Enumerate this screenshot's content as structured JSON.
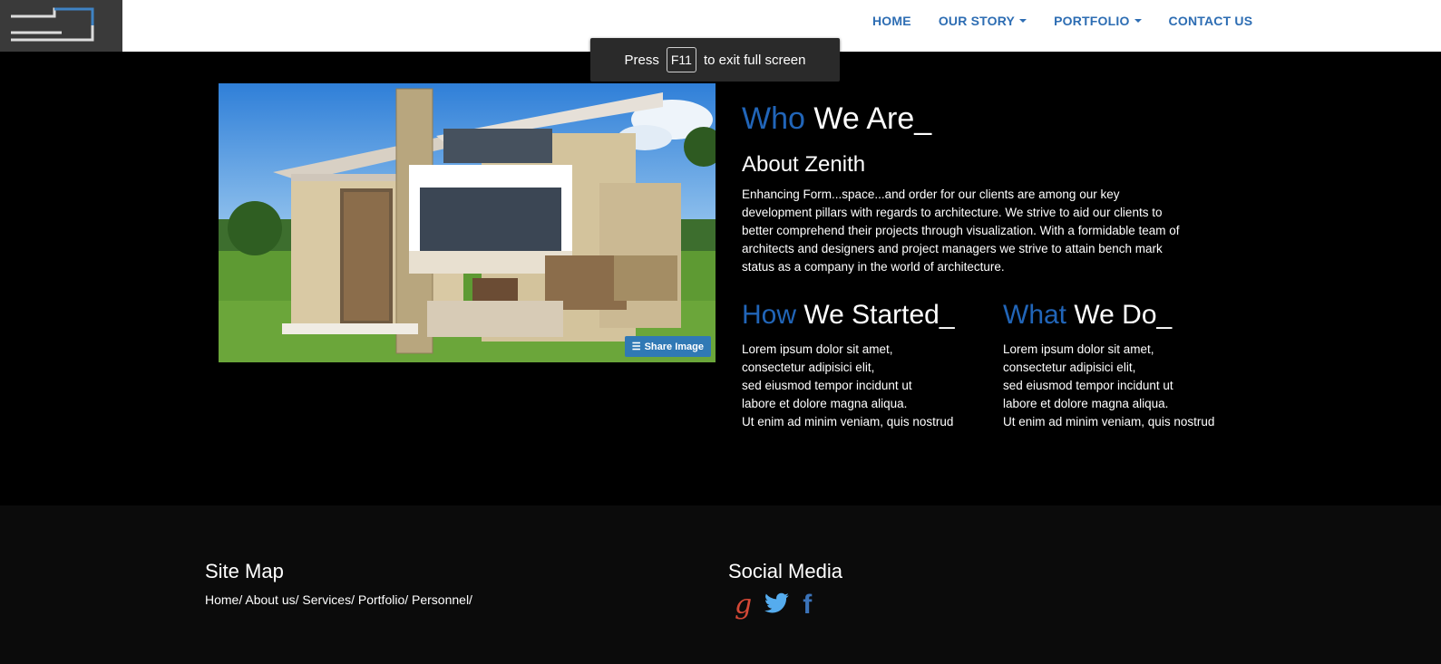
{
  "nav": {
    "items": [
      {
        "label": "HOME",
        "dropdown": false
      },
      {
        "label": "OUR STORY",
        "dropdown": true
      },
      {
        "label": "PORTFOLIO",
        "dropdown": true
      },
      {
        "label": "CONTACT US",
        "dropdown": false
      }
    ]
  },
  "fullscreen_toast": {
    "press": "Press",
    "key": "F11",
    "suffix": "to exit full screen"
  },
  "hero": {
    "share_label": "Share Image"
  },
  "who": {
    "accent": "Who",
    "rest": " We Are_",
    "subtitle": "About Zenith",
    "lines": [
      "Enhancing Form...space...and order for our clients are among our key",
      "development pillars with regards to architecture. We strive to aid our clients to",
      "better comprehend their projects through visualization. With a formidable team of",
      "architects and designers and project managers we strive to attain bench mark",
      "status as a company in the world of architecture."
    ]
  },
  "how": {
    "accent": "How",
    "rest": " We Started_",
    "lines": [
      "Lorem ipsum dolor sit amet,",
      "consectetur adipisici elit,",
      "sed eiusmod tempor incidunt ut",
      "labore et dolore magna aliqua.",
      "Ut enim ad minim veniam, quis nostrud"
    ]
  },
  "what": {
    "accent": "What",
    "rest": " We Do_",
    "lines": [
      "Lorem ipsum dolor sit amet,",
      "consectetur adipisici elit,",
      "sed eiusmod tempor incidunt ut",
      "labore et dolore magna aliqua.",
      "Ut enim ad minim veniam, quis nostrud"
    ]
  },
  "footer": {
    "sitemap_title": "Site Map",
    "sitemap_links": [
      "Home/",
      "About us/",
      "Services/",
      "Portfolio/",
      "Personnel/"
    ],
    "social_title": "Social Media",
    "social": [
      {
        "icon": "google-plus-icon",
        "glyph": "g",
        "color": "#d34836"
      },
      {
        "icon": "twitter-icon",
        "glyph": "",
        "color": "#55acee"
      },
      {
        "icon": "facebook-icon",
        "glyph": "f",
        "color": "#3b73b9"
      }
    ]
  },
  "colors": {
    "accent": "#2165b8",
    "nav": "#2d6db3",
    "footer_bg": "#0b0b0b"
  }
}
